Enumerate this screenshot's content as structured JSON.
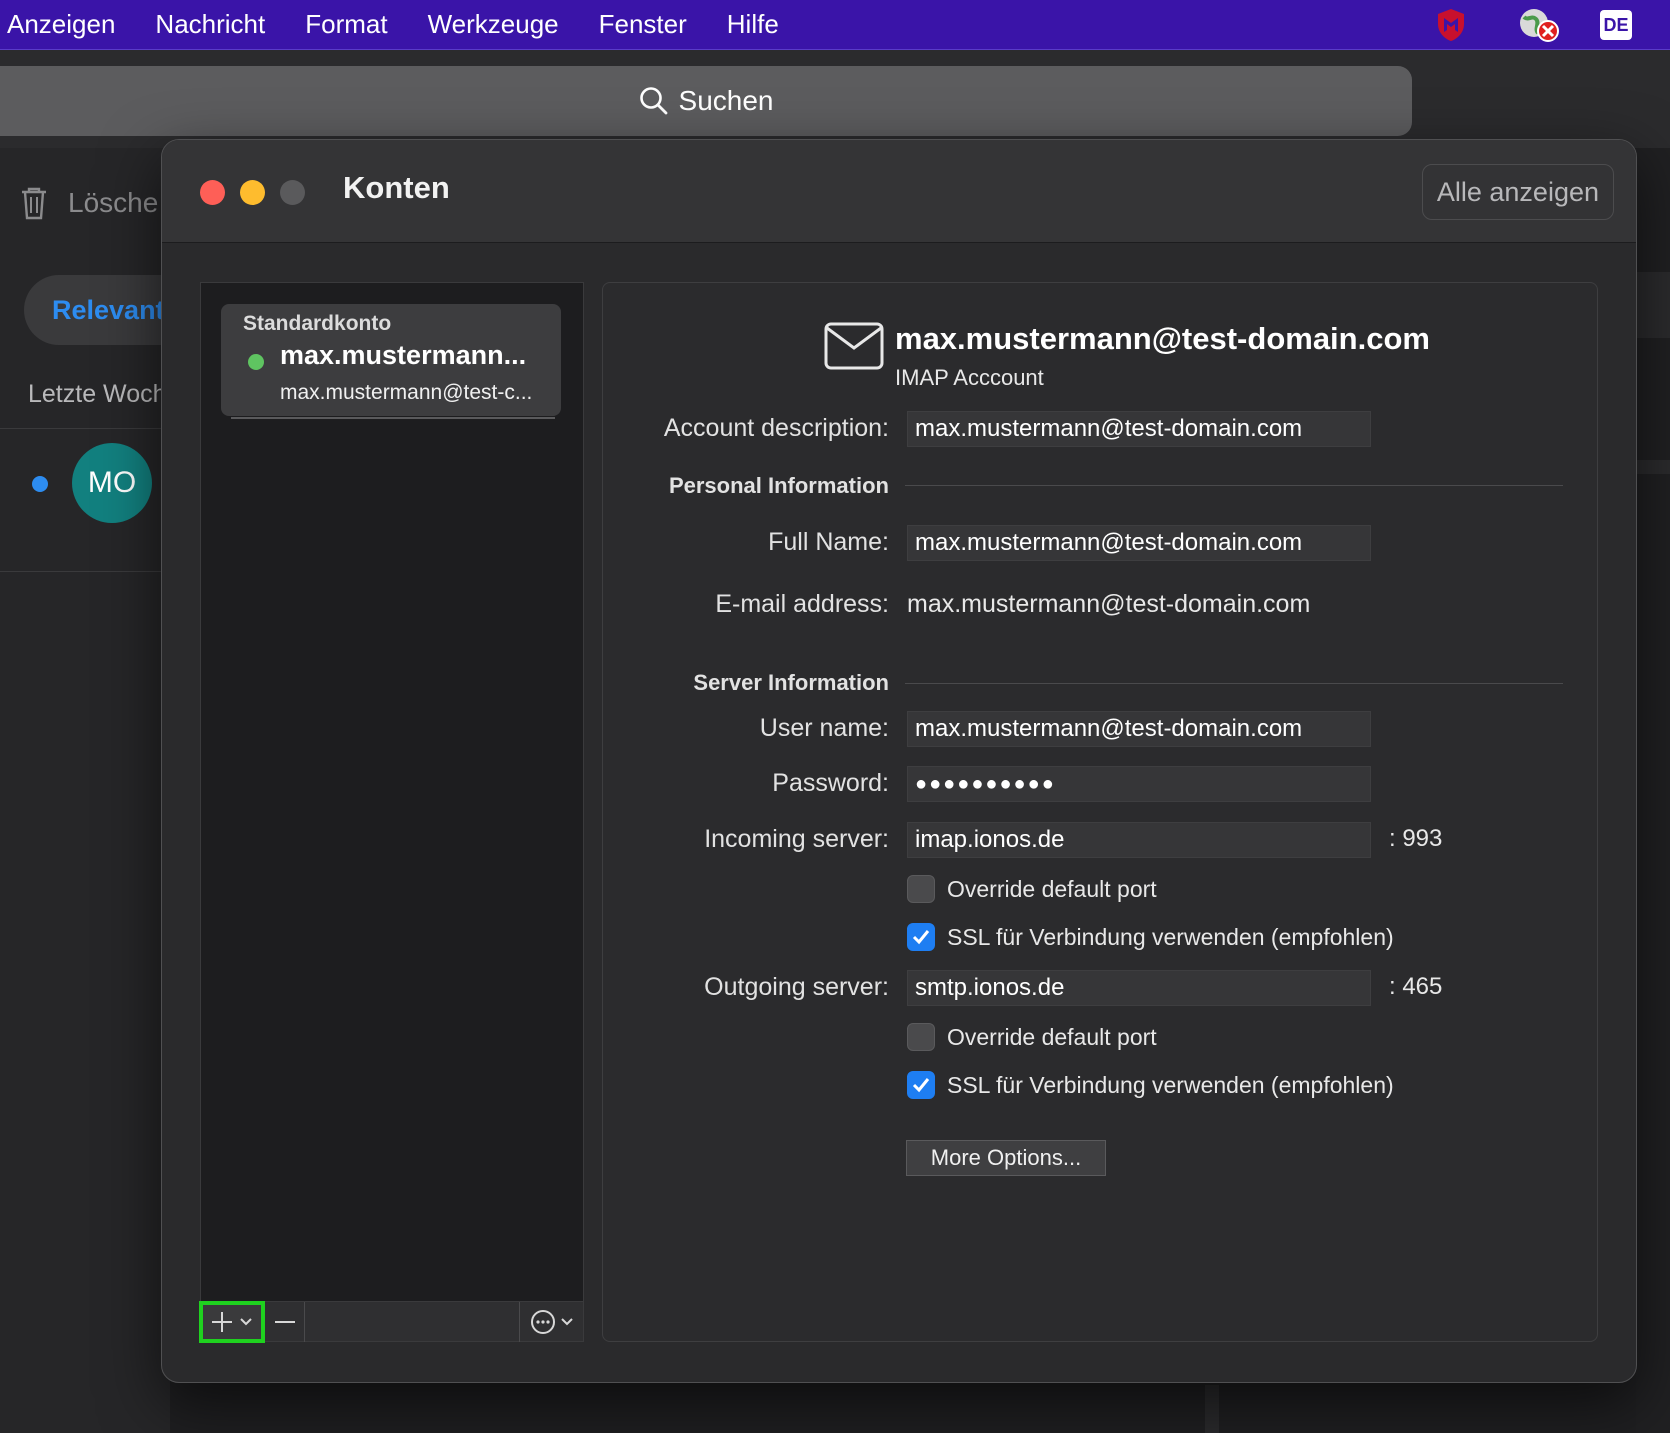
{
  "menubar": {
    "items": [
      "Anzeigen",
      "Nachricht",
      "Format",
      "Werkzeuge",
      "Fenster",
      "Hilfe"
    ],
    "language_badge": "DE"
  },
  "search": {
    "label": "Suchen"
  },
  "background": {
    "delete_label": "Lösche",
    "relevant_tab": "Relevant",
    "section_label": "Letzte Woch",
    "avatar_initials": "MO"
  },
  "dialog": {
    "title": "Konten",
    "show_all_button": "Alle anzeigen",
    "accounts": [
      {
        "group_label": "Standardkonto",
        "name": "max.mustermann...",
        "email": "max.mustermann@test-c...",
        "status": "online"
      }
    ],
    "details": {
      "email": "max.mustermann@test-domain.com",
      "account_type": "IMAP Acccount",
      "account_description_label": "Account description:",
      "account_description": "max.mustermann@test-domain.com",
      "personal_section": "Personal Information",
      "full_name_label": "Full Name:",
      "full_name": "max.mustermann@test-domain.com",
      "email_label": "E-mail address:",
      "email_address": "max.mustermann@test-domain.com",
      "server_section": "Server Information",
      "username_label": "User name:",
      "username": "max.mustermann@test-domain.com",
      "password_label": "Password:",
      "password_mask": "●●●●●●●●●●",
      "incoming_label": "Incoming server:",
      "incoming_server": "imap.ionos.de",
      "incoming_port": ": 993",
      "override_port_label": "Override default port",
      "ssl_label": "SSL für Verbindung verwenden (empfohlen)",
      "outgoing_label": "Outgoing server:",
      "outgoing_server": "smtp.ionos.de",
      "outgoing_port": ": 465",
      "more_options": "More Options..."
    }
  },
  "colors": {
    "menubar": "#3a14a8",
    "accent_blue": "#1e7ef2",
    "highlight_green": "#1fd21f",
    "status_green": "#5fc461"
  }
}
